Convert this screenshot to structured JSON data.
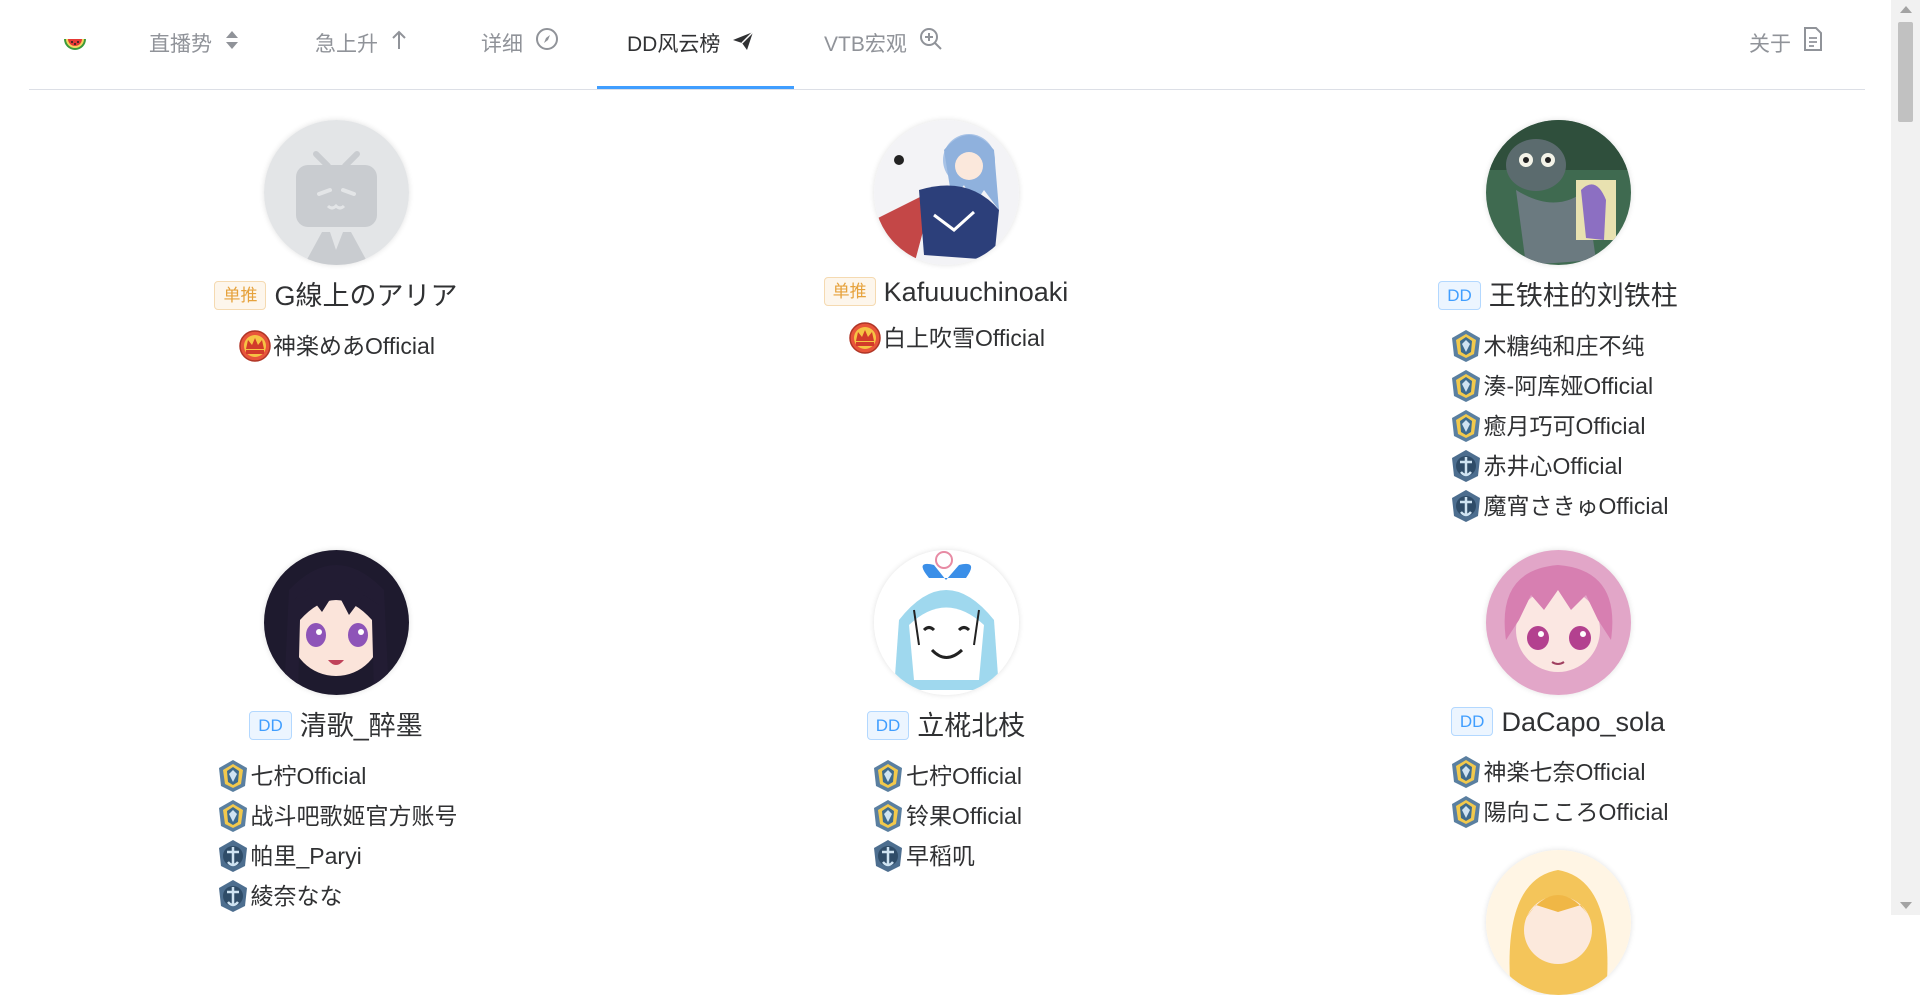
{
  "nav": {
    "items": [
      {
        "label": "直播势",
        "icon": "sort-updown-icon"
      },
      {
        "label": "急上升",
        "icon": "arrow-up-icon"
      },
      {
        "label": "详细",
        "icon": "compass-icon"
      },
      {
        "label": "DD风云榜",
        "icon": "paper-plane-icon"
      },
      {
        "label": "VTB宏观",
        "icon": "zoom-in-icon"
      }
    ],
    "about": {
      "label": "关于",
      "icon": "document-icon"
    },
    "active_index": 3,
    "accent": "#409eff"
  },
  "tags": {
    "single": "单推",
    "dd": "DD"
  },
  "cards": [
    {
      "tag": "单推",
      "name": "G線上のアリア",
      "follows": [
        {
          "name": "神楽めあOfficial",
          "medal": "crown"
        }
      ]
    },
    {
      "tag": "单推",
      "name": "Kafuuuchinoaki",
      "follows": [
        {
          "name": "白上吹雪Official",
          "medal": "crown"
        }
      ]
    },
    {
      "tag": "DD",
      "name": "王铁柱的刘铁柱",
      "follows": [
        {
          "name": "木糖纯和庄不纯",
          "medal": "admiral"
        },
        {
          "name": "湊-阿库娅Official",
          "medal": "admiral"
        },
        {
          "name": "癒月巧可Official",
          "medal": "admiral"
        },
        {
          "name": "赤井心Official",
          "medal": "captain"
        },
        {
          "name": "魔宵さきゅOfficial",
          "medal": "captain"
        }
      ]
    },
    {
      "tag": "DD",
      "name": "清歌_醉墨",
      "follows": [
        {
          "name": "七柠Official",
          "medal": "admiral"
        },
        {
          "name": "战斗吧歌姬官方账号",
          "medal": "admiral"
        },
        {
          "name": "帕里_Paryi",
          "medal": "captain"
        },
        {
          "name": "綾奈なな",
          "medal": "captain"
        }
      ]
    },
    {
      "tag": "DD",
      "name": "立椛北枝",
      "follows": [
        {
          "name": "七柠Official",
          "medal": "admiral"
        },
        {
          "name": "铃果Official",
          "medal": "admiral"
        },
        {
          "name": "早稻叽",
          "medal": "captain"
        }
      ]
    },
    {
      "tag": "DD",
      "name": "DaCapo_sola",
      "follows": [
        {
          "name": "神楽七奈Official",
          "medal": "admiral"
        },
        {
          "name": "陽向こころOfficial",
          "medal": "admiral"
        }
      ]
    }
  ]
}
